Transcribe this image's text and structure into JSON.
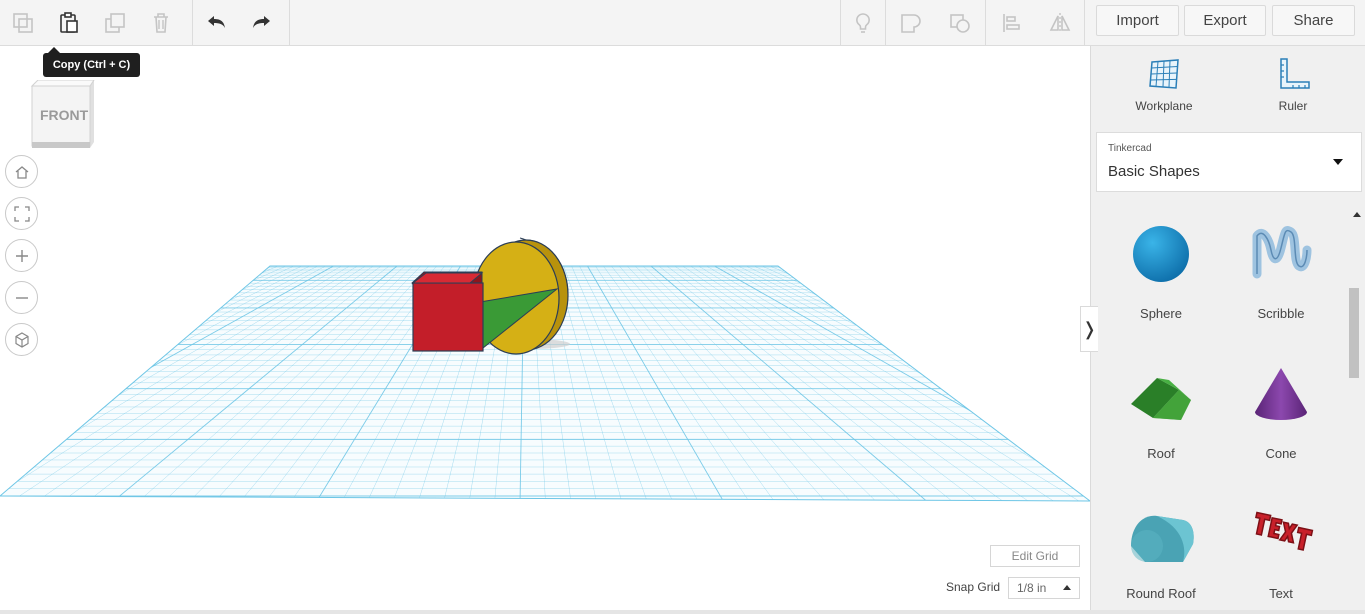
{
  "toolbar": {
    "tools_left": [
      "duplicate-icon",
      "copy-icon",
      "paste-icon",
      "delete-icon"
    ],
    "undo_icon": "undo-icon",
    "redo_icon": "redo-icon",
    "tools_right": [
      "lightbulb-icon",
      "group-icon",
      "ungroup-icon",
      "align-icon",
      "mirror-icon"
    ],
    "import_label": "Import",
    "export_label": "Export",
    "share_label": "Share"
  },
  "tooltip": {
    "text": "Copy (Ctrl + C)"
  },
  "viewcube": {
    "label": "FRONT"
  },
  "nav": [
    "home-icon",
    "fit-icon",
    "zoom-in-icon",
    "zoom-out-icon",
    "perspective-icon"
  ],
  "viewport": {
    "edit_grid_label": "Edit Grid",
    "snap_grid_label": "Snap Grid",
    "snap_grid_value": "1/8 in"
  },
  "panel": {
    "workplane_label": "Workplane",
    "ruler_label": "Ruler",
    "library_small": "Tinkercad",
    "library_name": "Basic Shapes",
    "shapes": [
      {
        "name": "Sphere",
        "color": "#1a90c8"
      },
      {
        "name": "Scribble",
        "color": "#8fb7d9"
      },
      {
        "name": "Roof",
        "color": "#2e8a2e"
      },
      {
        "name": "Cone",
        "color": "#7a3a9a"
      },
      {
        "name": "Round Roof",
        "color": "#5bb6c4"
      },
      {
        "name": "Text",
        "color": "#c8202a"
      }
    ]
  },
  "colors": {
    "grid": "#6ec6e6",
    "box": "#c4202b",
    "cylinder": "#d4ad14",
    "wedge": "#3a9a36"
  }
}
